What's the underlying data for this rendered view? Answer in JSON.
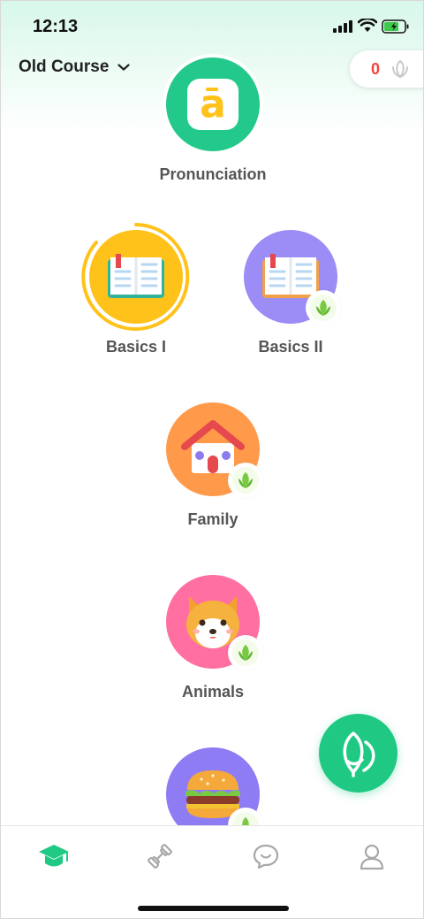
{
  "status_bar": {
    "time": "12:13"
  },
  "header": {
    "course_label": "Old Course",
    "coins": "0"
  },
  "lessons": [
    {
      "label": "Pronunciation",
      "glyph": "ā"
    },
    {
      "label": "Basics I"
    },
    {
      "label": "Basics II"
    },
    {
      "label": "Family"
    },
    {
      "label": "Animals"
    },
    {
      "label": ""
    }
  ],
  "icons": {
    "tabs": [
      "graduation-cap-icon",
      "dumbbell-icon",
      "chat-icon",
      "profile-icon"
    ],
    "fab": "leaf-icon"
  },
  "colors": {
    "accent": "#1fc984",
    "pronunciation": "#22c98a",
    "basics1": "#ffc21a",
    "basics2": "#9b8cf6",
    "family": "#ff9a4a",
    "animals": "#ff6fa2",
    "food": "#8e7cf4",
    "coin": "#f0443d"
  }
}
